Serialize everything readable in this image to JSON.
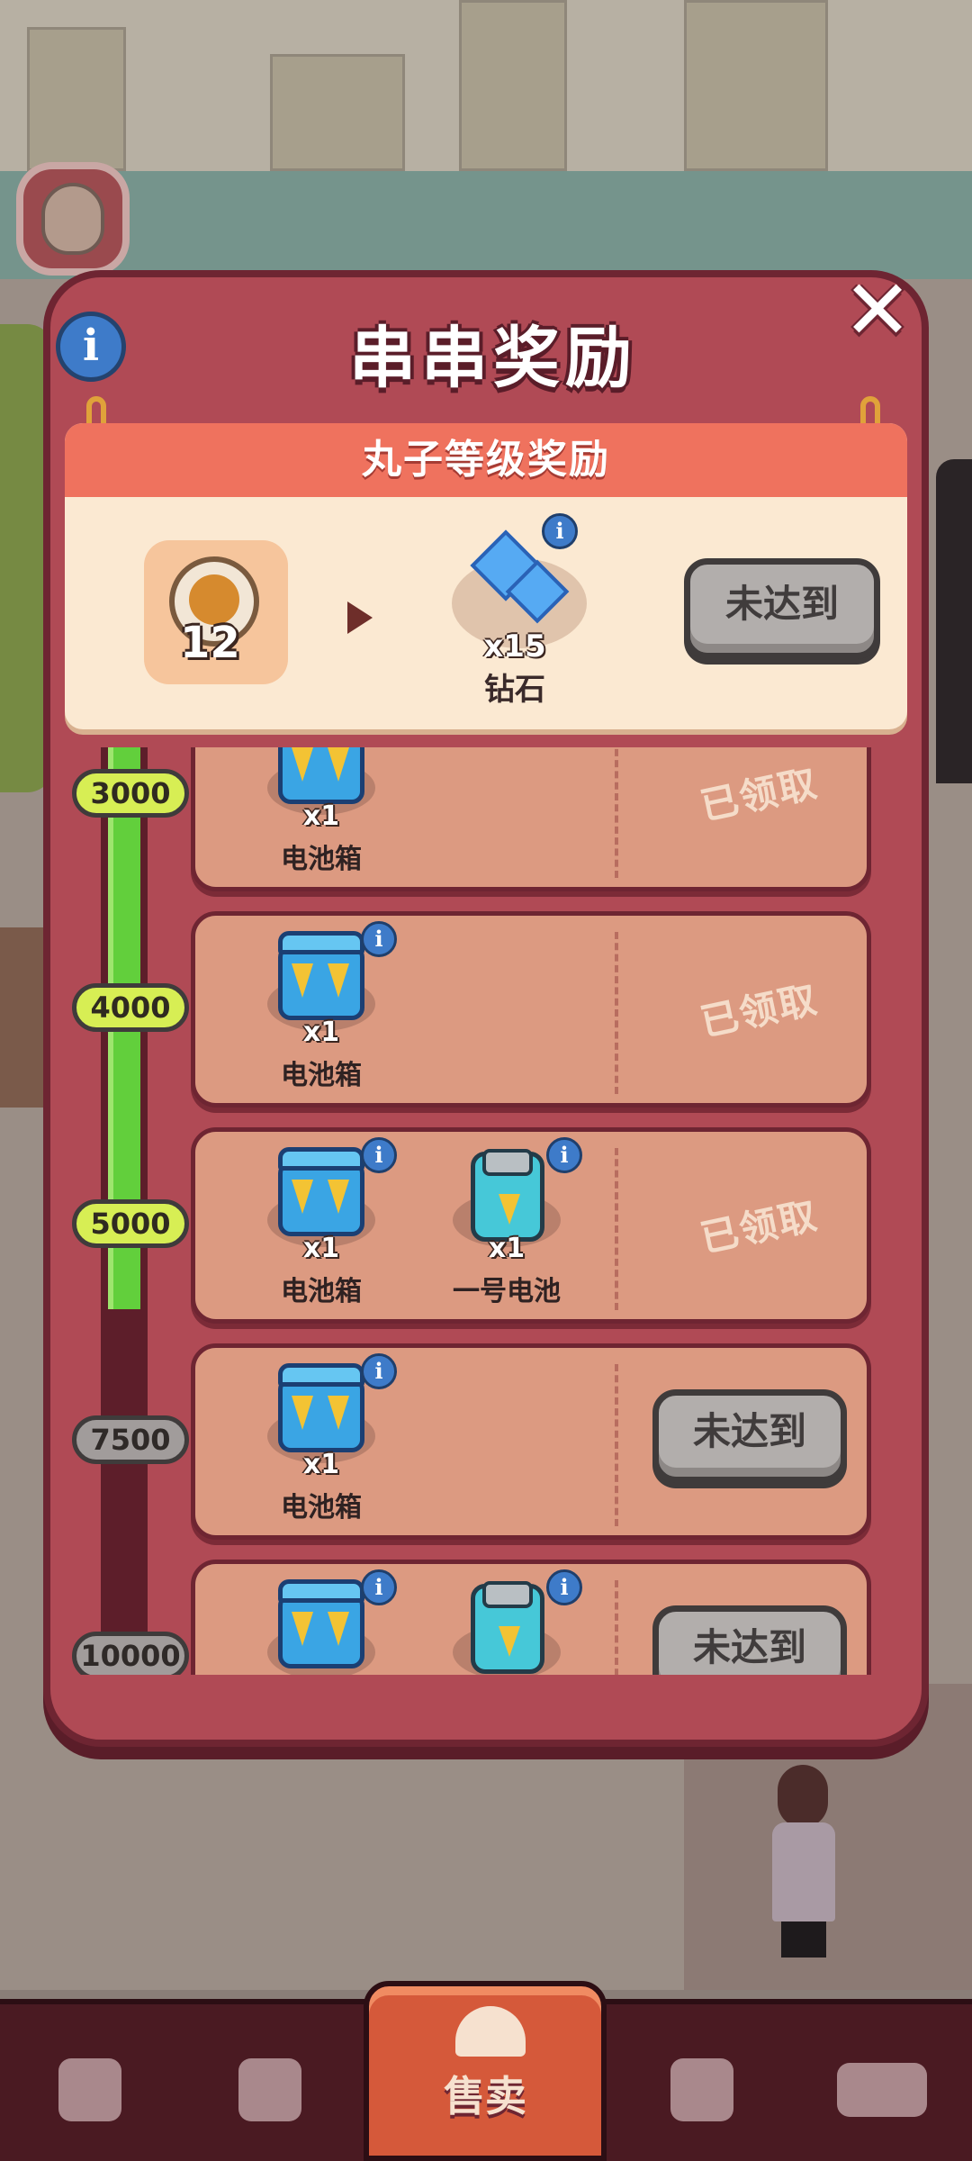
{
  "modal": {
    "title": "串串奖励",
    "close_label": "✕",
    "info_label": "i"
  },
  "top_reward": {
    "header": "丸子等级奖励",
    "current_level": "12",
    "reward": {
      "qty": "x15",
      "name": "钻石",
      "icon": "diamond-icon"
    },
    "button_label": "未达到"
  },
  "progress": {
    "fill_fraction": 0.6
  },
  "rewards": [
    {
      "level": "3000",
      "reached": true,
      "status": "已领取",
      "items": [
        {
          "qty": "x1",
          "name": "电池箱",
          "icon": "battery-crate-icon"
        }
      ]
    },
    {
      "level": "4000",
      "reached": true,
      "status": "已领取",
      "items": [
        {
          "qty": "x1",
          "name": "电池箱",
          "icon": "battery-crate-icon"
        }
      ]
    },
    {
      "level": "5000",
      "reached": true,
      "status": "已领取",
      "items": [
        {
          "qty": "x1",
          "name": "电池箱",
          "icon": "battery-crate-icon"
        },
        {
          "qty": "x1",
          "name": "一号电池",
          "icon": "battery-icon"
        }
      ]
    },
    {
      "level": "7500",
      "reached": false,
      "status": "未达到",
      "items": [
        {
          "qty": "x1",
          "name": "电池箱",
          "icon": "battery-crate-icon"
        }
      ]
    },
    {
      "level": "10000",
      "reached": false,
      "status": "未达到",
      "items": [
        {
          "qty": "",
          "name": "",
          "icon": "battery-crate-icon"
        },
        {
          "qty": "",
          "name": "",
          "icon": "battery-icon"
        }
      ]
    }
  ],
  "nav": {
    "tabs": [
      {
        "icon": "bag-icon"
      },
      {
        "icon": "handshake-icon"
      },
      {
        "label": "售卖",
        "icon": "service-bell-icon",
        "active": true
      },
      {
        "icon": "map-person-icon"
      },
      {
        "icon": "bus-icon"
      }
    ]
  },
  "colors": {
    "modal_bg": "#b04a55",
    "modal_border": "#6e2532",
    "header_bar": "#ef725e",
    "progress_fill": "#62cf3c",
    "level_reached": "#d7ee54",
    "level_pending": "#a19c9b",
    "nav_active": "#d5593a"
  }
}
